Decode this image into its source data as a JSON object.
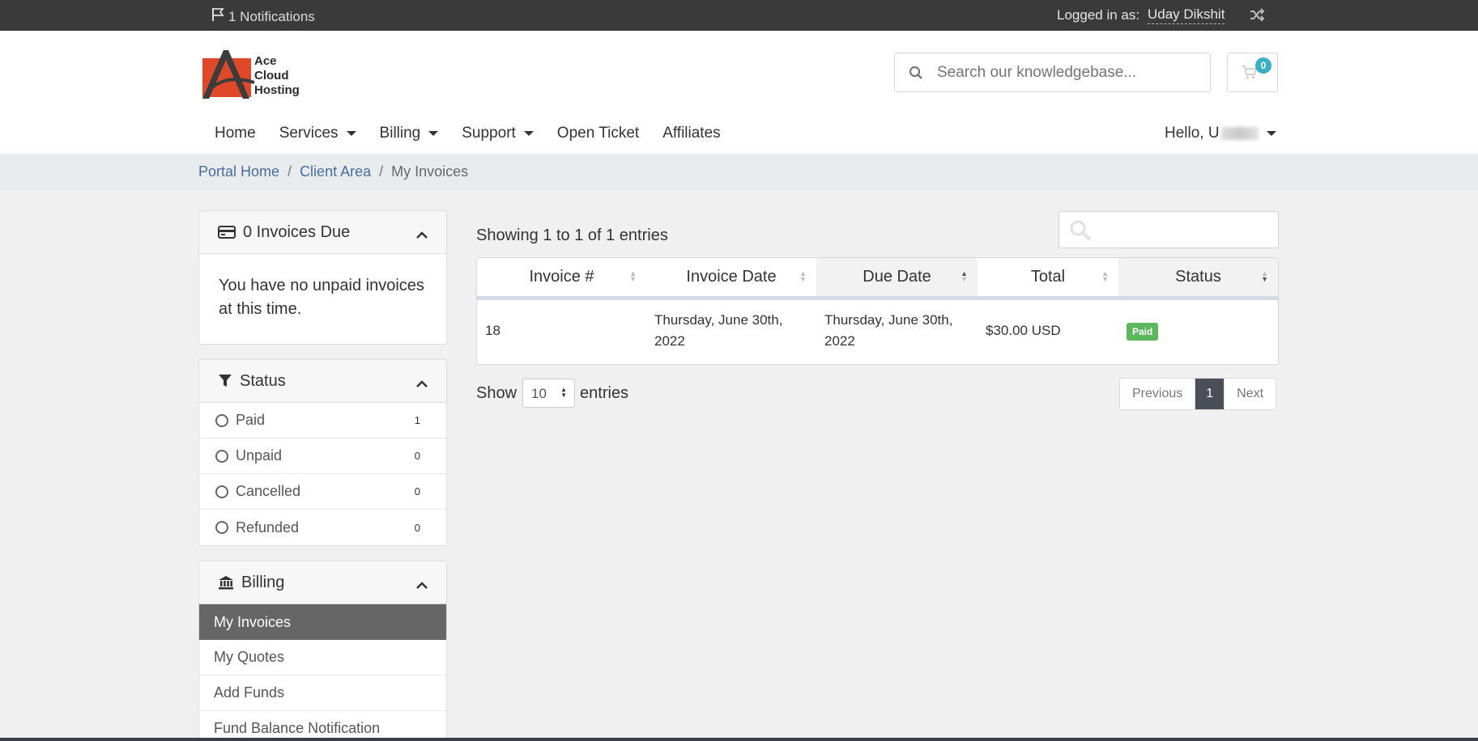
{
  "topbar": {
    "notifications": "1 Notifications",
    "logged_in_label": "Logged in as:",
    "user_name": "Uday Dikshit"
  },
  "header": {
    "logo_line1": "Ace",
    "logo_line2": "Cloud",
    "logo_line3": "Hosting",
    "search_placeholder": "Search our knowledgebase...",
    "cart_count": "0"
  },
  "nav": {
    "home": "Home",
    "services": "Services",
    "billing": "Billing",
    "support": "Support",
    "open_ticket": "Open Ticket",
    "affiliates": "Affiliates",
    "hello": "Hello, U"
  },
  "breadcrumb": {
    "portal_home": "Portal Home",
    "client_area": "Client Area",
    "current": "My Invoices"
  },
  "sidebar": {
    "invoices_due": {
      "title": "0 Invoices Due",
      "message": "You have no unpaid invoices at this time."
    },
    "status": {
      "title": "Status",
      "items": [
        {
          "label": "Paid",
          "count": "1"
        },
        {
          "label": "Unpaid",
          "count": "0"
        },
        {
          "label": "Cancelled",
          "count": "0"
        },
        {
          "label": "Refunded",
          "count": "0"
        }
      ]
    },
    "billing": {
      "title": "Billing",
      "items": [
        {
          "label": "My Invoices"
        },
        {
          "label": "My Quotes"
        },
        {
          "label": "Add Funds"
        },
        {
          "label": "Fund Balance Notification"
        }
      ]
    }
  },
  "table": {
    "showing": "Showing 1 to 1 of 1 entries",
    "columns": [
      "Invoice #",
      "Invoice Date",
      "Due Date",
      "Total",
      "Status"
    ],
    "rows": [
      {
        "invoice": "18",
        "invoice_date": "Thursday, June 30th, 2022",
        "due_date": "Thursday, June 30th, 2022",
        "total": "$30.00 USD",
        "status": "Paid"
      }
    ],
    "show_label": "Show",
    "page_size": "10",
    "entries_label": "entries",
    "pagination": {
      "previous": "Previous",
      "current": "1",
      "next": "Next"
    }
  },
  "colors": {
    "topbar": "#3a3a3a",
    "cart_badge": "#3ab0c6",
    "paid_badge": "#5cb85c",
    "active_menu": "#666666",
    "logo_red": "#e0482a"
  }
}
